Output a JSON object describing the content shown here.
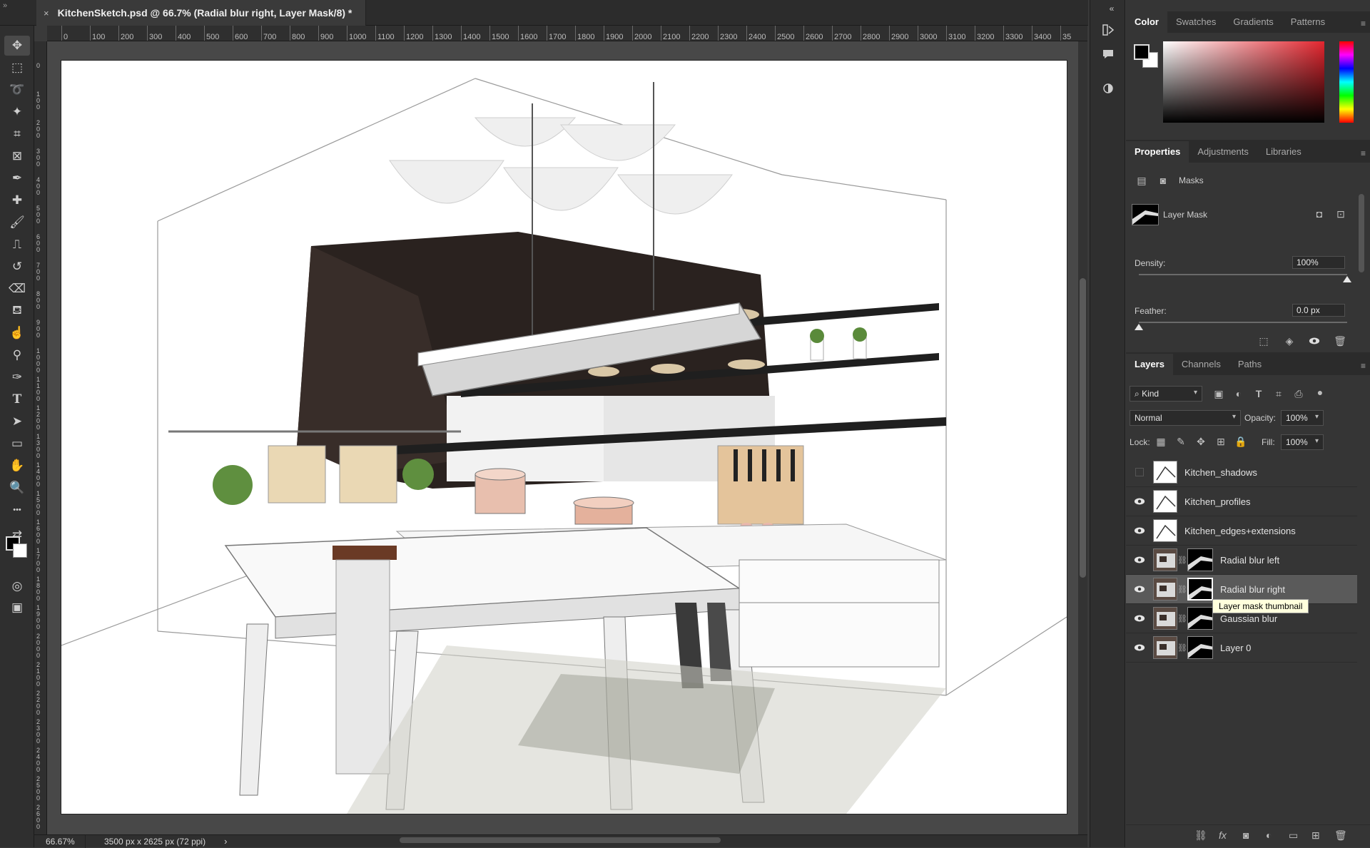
{
  "document": {
    "tab_title": "KitchenSketch.psd @ 66.7% (Radial blur right, Layer Mask/8) *",
    "close_glyph": "×"
  },
  "toolbar": {
    "tools": [
      "move-icon",
      "marquee-icon",
      "lasso-icon",
      "magic-wand-icon",
      "crop-icon",
      "frame-icon",
      "eyedropper-icon",
      "healing-brush-icon",
      "brush-icon",
      "clone-stamp-icon",
      "history-brush-icon",
      "eraser-icon",
      "paint-bucket-icon",
      "smudge-icon",
      "dodge-icon",
      "pen-icon",
      "type-icon",
      "path-selection-icon",
      "rectangle-icon",
      "hand-icon",
      "zoom-icon",
      "more-tools-icon"
    ]
  },
  "ruler": {
    "top_labels": [
      "0",
      "100",
      "200",
      "300",
      "400",
      "500",
      "600",
      "700",
      "800",
      "900",
      "1000",
      "1100",
      "1200",
      "1300",
      "1400",
      "1500",
      "1600",
      "1700",
      "1800",
      "1900",
      "2000",
      "2100",
      "2200",
      "2300",
      "2400",
      "2500",
      "2600",
      "2700",
      "2800",
      "2900",
      "3000",
      "3100",
      "3200",
      "3300",
      "3400",
      "35"
    ],
    "left_labels": [
      "0",
      "100",
      "200",
      "300",
      "400",
      "500",
      "600",
      "700",
      "800",
      "900",
      "1000",
      "1100",
      "1200",
      "1300",
      "1400",
      "1500",
      "1600",
      "1700",
      "1800",
      "1900",
      "2000",
      "2100",
      "2200",
      "2300",
      "2400",
      "2500",
      "2600"
    ]
  },
  "status": {
    "zoom": "66.67%",
    "doc_size": "3500 px x 2625 px (72 ppi)",
    "arrow": "›"
  },
  "color_panel": {
    "tabs": [
      "Color",
      "Swatches",
      "Gradients",
      "Patterns"
    ],
    "foreground": "#000000",
    "background": "#ffffff",
    "hue_color": "#e3262f"
  },
  "properties_panel": {
    "tabs": [
      "Properties",
      "Adjustments",
      "Libraries"
    ],
    "section_label": "Masks",
    "mask_label": "Layer Mask",
    "density_label": "Density:",
    "density_value": "100%",
    "density_level": 1.0,
    "feather_label": "Feather:",
    "feather_value": "0.0 px",
    "feather_level": 0.0
  },
  "layers_panel": {
    "tabs": [
      "Layers",
      "Channels",
      "Paths"
    ],
    "filter_label": "Kind",
    "blend_mode": "Normal",
    "opacity_label": "Opacity:",
    "opacity_value": "100%",
    "lock_label": "Lock:",
    "fill_label": "Fill:",
    "fill_value": "100%",
    "layers": [
      {
        "name": "Kitchen_shadows",
        "visible": false,
        "has_mask": false,
        "selected": false
      },
      {
        "name": "Kitchen_profiles",
        "visible": true,
        "has_mask": false,
        "selected": false
      },
      {
        "name": "Kitchen_edges+extensions",
        "visible": true,
        "has_mask": false,
        "selected": false
      },
      {
        "name": "Radial blur left",
        "visible": true,
        "has_mask": true,
        "selected": false
      },
      {
        "name": "Radial blur right",
        "visible": true,
        "has_mask": true,
        "selected": true
      },
      {
        "name": "Gaussian blur",
        "visible": true,
        "has_mask": true,
        "selected": false
      },
      {
        "name": "Layer 0",
        "visible": true,
        "has_mask": true,
        "selected": false
      }
    ],
    "tooltip": "Layer mask thumbnail"
  }
}
